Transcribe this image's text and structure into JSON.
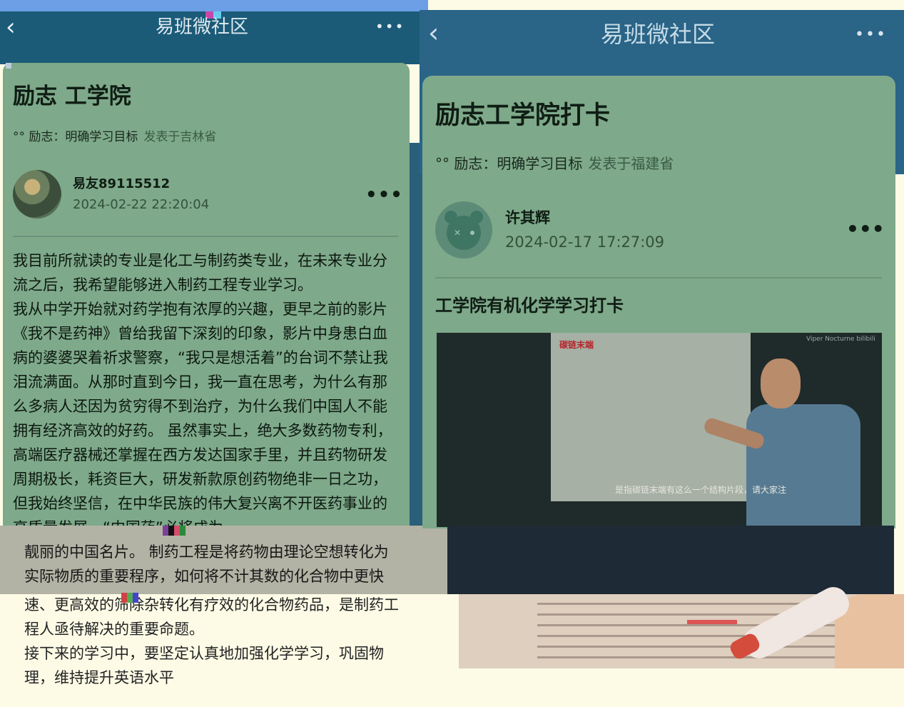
{
  "left": {
    "topbar": {
      "title": "易班微社区",
      "more": "•••"
    },
    "post": {
      "heading": "励志 工学院",
      "meta_prefix": "°° 励志：明确学习目标",
      "meta_location": "发表于吉林省",
      "author": "易友89115512",
      "date": "2024-02-22 22:20:04",
      "body": [
        "  我目前所就读的专业是化工与制药类专业，在未来专业分流之后，我希望能够进入制药工程专业学习。",
        " 我从中学开始就对药学抱有浓厚的兴趣，更早之前的影片《我不是药神》曾给我留下深刻的印象，影片中身患白血病的婆婆哭着祈求警察，“我只是想活着”的台词不禁让我泪流满面。从那时直到今日，我一直在思考，为什么有那么多病人还因为贫穷得不到治疗，为什么我们中国人不能拥有经济高效的好药。 虽然事实上，绝大多数药物专利，高端医疗器械还掌握在西方发达国家手里，并且药物研发周期极长，耗资巨大，研发新款原创药物绝非一日之功，但我始终坚信，在中华民族的伟大复兴离不开医药事业的高质量发展，“中国药”必将成为"
      ]
    },
    "band": [
      "靓丽的中国名片。 制药工程是将药物由理论空想转化为",
      "实际物质的重要程序，如何将不计其数的化合物中更快"
    ],
    "bottom": [
      "速、更高效的筛除杂转化有疗效的化合物药品，是制药工",
      "  程人亟待解决的重要命题。",
      "   接下来的学习中，要坚定认真地加强化学学习，巩固物",
      "  理，维持提升英语水平"
    ]
  },
  "right": {
    "topbar": {
      "title": "易班微社区",
      "more": "•••"
    },
    "post": {
      "heading": "励志工学院打卡",
      "meta_prefix": "°° 励志：明确学习目标",
      "meta_location": "发表于福建省",
      "author": "许其辉",
      "date": "2024-02-17 17:27:09",
      "subheading": "工学院有机化学学习打卡",
      "video": {
        "board_label": "碳链末端",
        "caption": "是指碳链末端有这么一个结构片段，请大家注",
        "watermark": "Viper Nocturne bilibili"
      }
    }
  },
  "icons": {
    "back": "back-chevron-icon",
    "more": "more-dots-icon"
  },
  "colors": {
    "nav_bar": "#1b5b78",
    "card": "#7ea98a",
    "page_background": "#fdfbe6"
  }
}
